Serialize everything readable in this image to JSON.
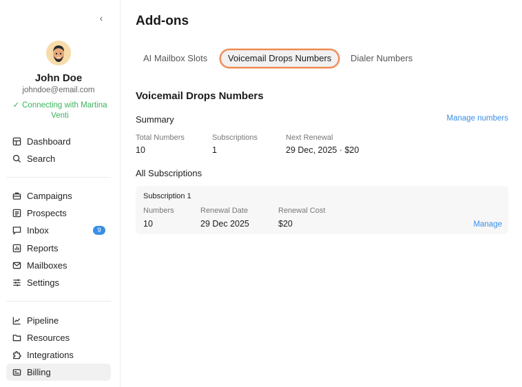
{
  "sidebar": {
    "collapse_icon": "chevron-left-icon",
    "user": {
      "name": "John Doe",
      "email": "johndoe@email.com",
      "status": "Connecting with Martina Venti",
      "status_color": "#3bb35c"
    },
    "nav_top": [
      {
        "label": "Dashboard",
        "icon": "dashboard-icon"
      },
      {
        "label": "Search",
        "icon": "search-icon"
      }
    ],
    "nav_mid": [
      {
        "label": "Campaigns",
        "icon": "briefcase-icon"
      },
      {
        "label": "Prospects",
        "icon": "list-icon"
      },
      {
        "label": "Inbox",
        "icon": "chat-icon",
        "badge": "9"
      },
      {
        "label": "Reports",
        "icon": "bar-chart-icon"
      },
      {
        "label": "Mailboxes",
        "icon": "mail-icon"
      },
      {
        "label": "Settings",
        "icon": "sliders-icon"
      }
    ],
    "nav_bottom": [
      {
        "label": "Pipeline",
        "icon": "trend-icon"
      },
      {
        "label": "Resources",
        "icon": "folder-icon"
      },
      {
        "label": "Integrations",
        "icon": "puzzle-icon"
      },
      {
        "label": "Billing",
        "icon": "card-icon",
        "active": true
      }
    ]
  },
  "main": {
    "title": "Add-ons",
    "tabs": [
      {
        "label": "AI Mailbox Slots"
      },
      {
        "label": "Voicemail Drops Numbers",
        "active": true
      },
      {
        "label": "Dialer Numbers"
      }
    ],
    "section_title": "Voicemail Drops Numbers",
    "summary": {
      "label": "Summary",
      "manage_link": "Manage numbers",
      "stats": [
        {
          "label": "Total Numbers",
          "value": "10"
        },
        {
          "label": "Subscriptions",
          "value": "1"
        },
        {
          "label": "Next Renewal",
          "value": "29 Dec, 2025 · $20"
        }
      ]
    },
    "subscriptions_title": "All Subscriptions",
    "subscriptions": [
      {
        "name": "Subscription 1",
        "columns": [
          {
            "label": "Numbers",
            "value": "10"
          },
          {
            "label": "Renewal Date",
            "value": "29 Dec 2025"
          },
          {
            "label": "Renewal Cost",
            "value": "$20"
          }
        ],
        "action": "Manage"
      }
    ],
    "accent_color": "#3a8ee6",
    "highlight_color": "#ee8a54"
  }
}
